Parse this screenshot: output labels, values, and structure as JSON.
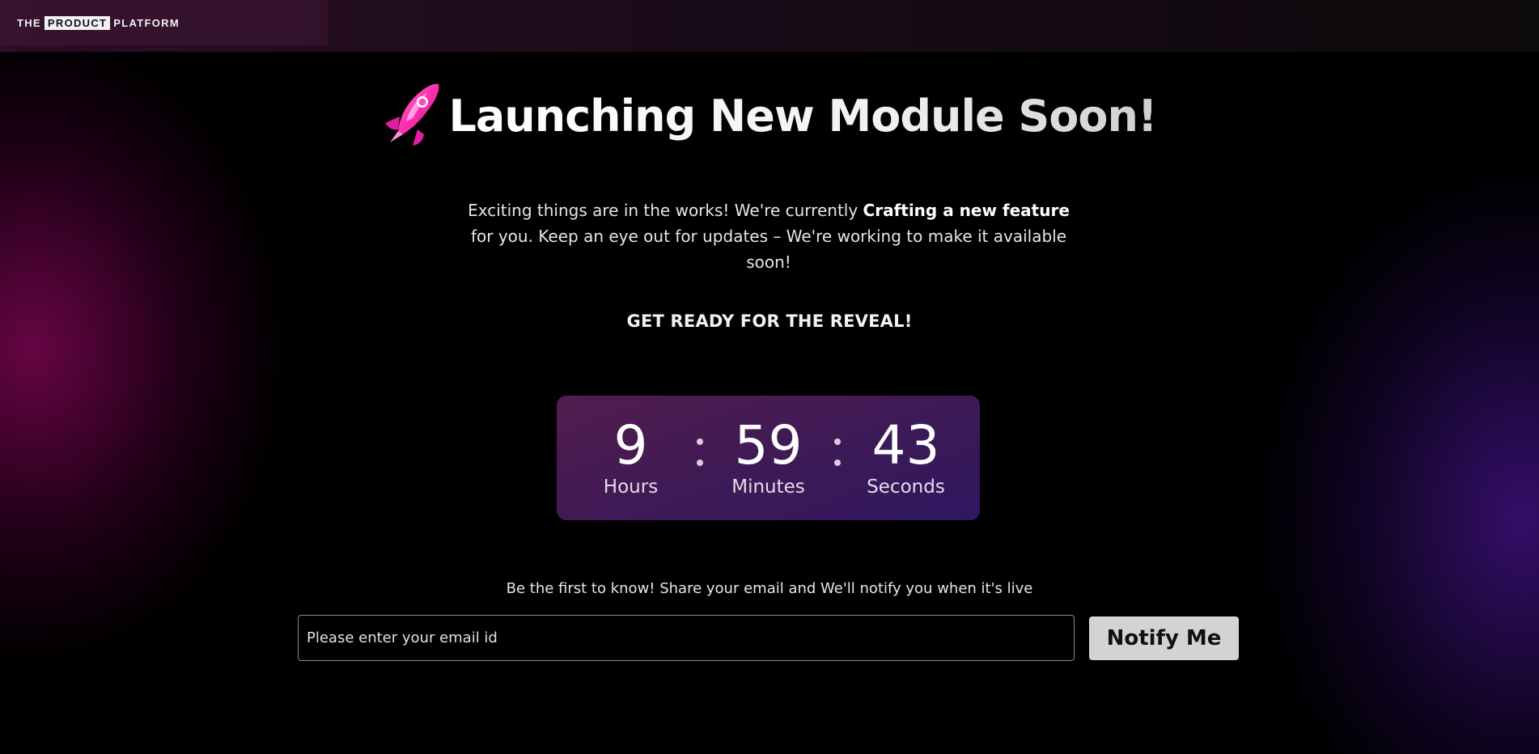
{
  "logo": {
    "prefix": "THE",
    "boxed": "PRODUCT",
    "suffix": "PLATFORM"
  },
  "hero": {
    "icon": "rocket-icon",
    "title": "Launching New Module Soon!"
  },
  "description": {
    "before": "Exciting things are in the works! We're currently ",
    "bold": "Crafting a new feature",
    "after": " for you. Keep an eye out for updates – We're working to make it available soon!"
  },
  "ready_text": "GET READY FOR THE REVEAL!",
  "countdown": {
    "hours": {
      "value": "9",
      "label": "Hours"
    },
    "minutes": {
      "value": "59",
      "label": "Minutes"
    },
    "seconds": {
      "value": "43",
      "label": "Seconds"
    }
  },
  "notify": {
    "text": "Be the first to know! Share your email and We'll notify you when it's live",
    "email_placeholder": "Please enter your email id",
    "email_value": "",
    "button_label": "Notify Me"
  },
  "colors": {
    "countdown_bg_start": "#521c4e",
    "countdown_bg_end": "#2f1760",
    "button_bg": "#d3d3d3",
    "glow_left": "#78064f",
    "glow_right": "#46148c",
    "rocket_pink": "#ff2fae"
  }
}
